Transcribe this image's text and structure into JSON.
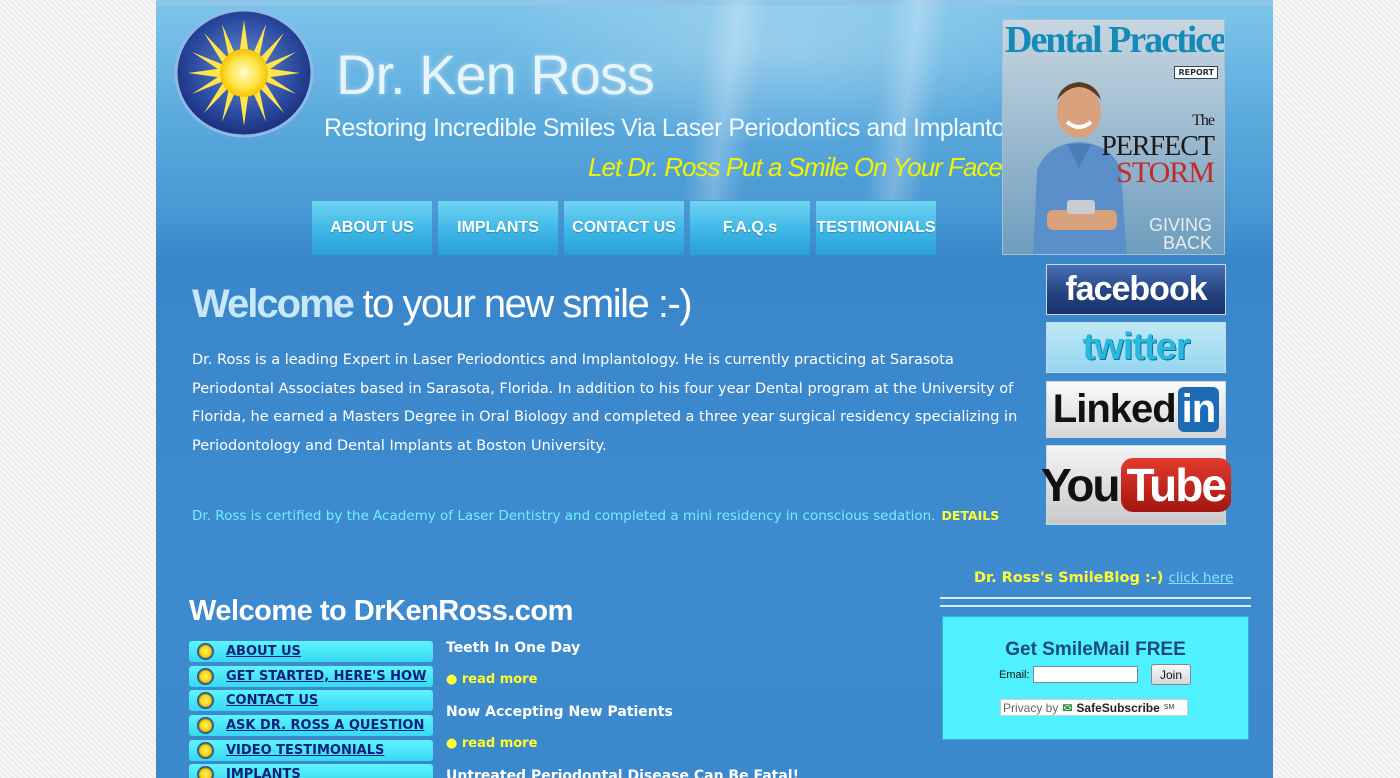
{
  "header": {
    "site_title": "Dr. Ken Ross",
    "tagline": "Restoring Incredible Smiles Via Laser Periodontics and Implantology!",
    "subtagline": "Let Dr. Ross Put a Smile On Your Face"
  },
  "nav": [
    "ABOUT US",
    "IMPLANTS",
    "CONTACT US",
    "F.A.Q.s",
    "TESTIMONIALS"
  ],
  "magazine": {
    "title": "Dental Practice",
    "report": "REPORT",
    "headline_1": "The",
    "headline_2": "PERFECT",
    "headline_3": "STORM",
    "giving": "GIVING",
    "back": "BACK"
  },
  "social": {
    "facebook": "facebook",
    "twitter": "twitter",
    "linked": "Linked",
    "in": "in",
    "you": "You",
    "tube": "Tube"
  },
  "main": {
    "welcome_1": "Welcome",
    "welcome_2": " to your new smile :-)",
    "intro": "Dr. Ross is a leading Expert in Laser Periodontics and Implantology. He is currently practicing at Sarasota Periodontal Associates based in Sarasota, Florida. In addition to his four year Dental program at the University of Florida, he earned a Masters Degree in Oral Biology and completed a three year surgical residency specializing in Periodontology and Dental Implants at Boston University.",
    "cert": "Dr. Ross is certified by the Academy of Laser Dentistry and completed a mini residency in conscious sedation.",
    "details": "DETAILS"
  },
  "blog": {
    "label": "Dr. Ross's SmileBlog :-)",
    "link": "click here"
  },
  "smilemail": {
    "title": "Get SmileMail FREE",
    "email_label": "Email:",
    "email_value": "",
    "join": "Join",
    "privacy": "Privacy by",
    "safesubscribe": "SafeSubscribe",
    "sm": "SM"
  },
  "lower": {
    "welcome_site": "Welcome to DrKenRoss.com",
    "menu": [
      "ABOUT US",
      "GET STARTED, HERE'S HOW",
      "CONTACT US",
      "ASK DR. ROSS A QUESTION",
      "VIDEO TESTIMONIALS",
      "IMPLANTS"
    ],
    "news": [
      {
        "title": "Teeth In One Day",
        "more": "● read more"
      },
      {
        "title": "Now Accepting New Patients",
        "more": "● read more"
      },
      {
        "title": "Untreated Periodontal Disease Can Be Fatal!",
        "more": ""
      }
    ]
  },
  "colors": {
    "accent_yellow": "#f4f200",
    "nav_cyan": "#3db7e6",
    "menu_cyan": "#4ff0ff",
    "link_navy": "#0a1e7a"
  }
}
